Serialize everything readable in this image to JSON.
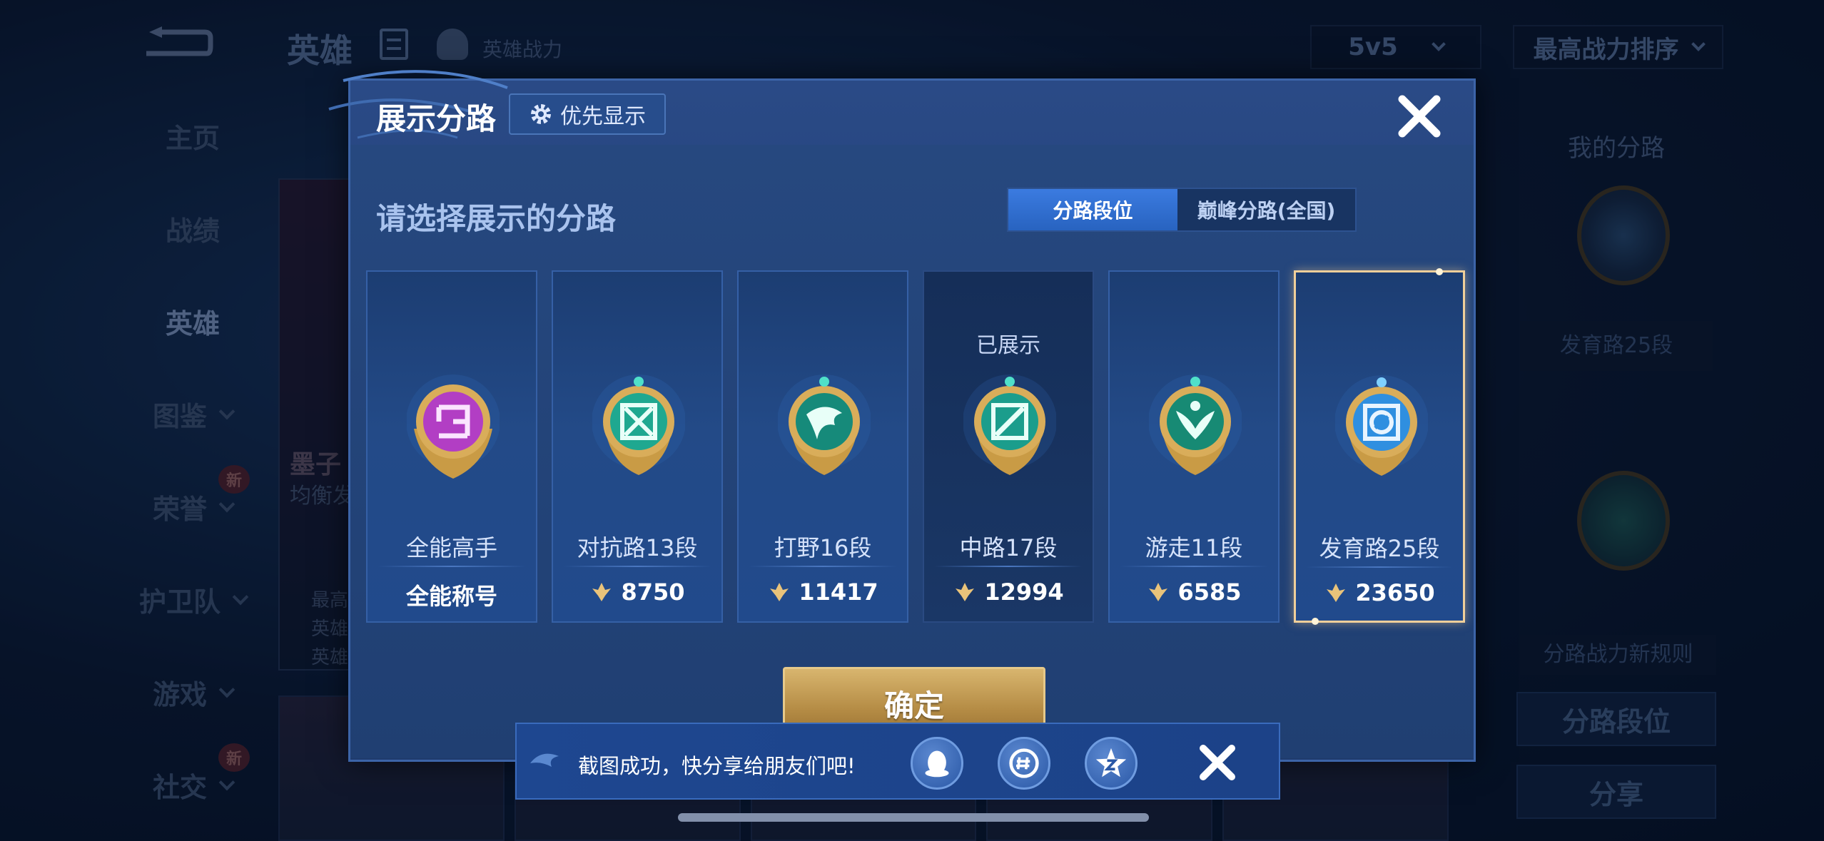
{
  "background": {
    "title": "英雄",
    "power_tab": "英雄战力",
    "mode_select": "5v5",
    "sort_select": "最高战力排序",
    "nav": [
      {
        "label": "主页",
        "active": false,
        "chevron": false,
        "new": false
      },
      {
        "label": "战绩",
        "active": false,
        "chevron": false,
        "new": false
      },
      {
        "label": "英雄",
        "active": true,
        "chevron": false,
        "new": false
      },
      {
        "label": "图鉴",
        "active": false,
        "chevron": true,
        "new": false
      },
      {
        "label": "荣誉",
        "active": false,
        "chevron": true,
        "new": true
      },
      {
        "label": "护卫队",
        "active": false,
        "chevron": true,
        "new": false
      },
      {
        "label": "游戏",
        "active": false,
        "chevron": true,
        "new": false
      },
      {
        "label": "社交",
        "active": false,
        "chevron": true,
        "new": true
      }
    ],
    "new_badge": "新",
    "hero_card": {
      "name": "墨子",
      "sub": "均衡发",
      "info": [
        "最高",
        "英雄",
        "英雄"
      ]
    },
    "right_panel": {
      "title": "我的分路",
      "badge_label": "发育路25段",
      "rule_link": "分路战力新规则",
      "lane_rank_button": "分路段位",
      "share_button": "分享"
    }
  },
  "modal": {
    "title": "展示分路",
    "priority_button": "优先显示",
    "prompt": "请选择展示的分路",
    "toggle": {
      "active": "分路段位",
      "inactive": "巅峰分路(全国)"
    },
    "cards": [
      {
        "name": "全能高手",
        "score": "全能称号",
        "has_power_icon": false,
        "status": "",
        "state": "normal",
        "badge_color": "#b23ec4",
        "badge_icon": "allround-badge-icon"
      },
      {
        "name": "对抗路13段",
        "score": "8750",
        "has_power_icon": true,
        "status": "",
        "state": "normal",
        "badge_color": "#1fa890",
        "badge_icon": "clash-lane-badge-icon"
      },
      {
        "name": "打野16段",
        "score": "11417",
        "has_power_icon": true,
        "status": "",
        "state": "normal",
        "badge_color": "#168a7a",
        "badge_icon": "jungle-badge-icon"
      },
      {
        "name": "中路17段",
        "score": "12994",
        "has_power_icon": true,
        "status": "已展示",
        "state": "shown",
        "badge_color": "#1b9d8c",
        "badge_icon": "mid-lane-badge-icon"
      },
      {
        "name": "游走11段",
        "score": "6585",
        "has_power_icon": true,
        "status": "",
        "state": "normal",
        "badge_color": "#178a74",
        "badge_icon": "roam-badge-icon"
      },
      {
        "name": "发育路25段",
        "score": "23650",
        "has_power_icon": true,
        "status": "",
        "state": "selected",
        "badge_color": "#2f8fe0",
        "badge_icon": "farm-lane-badge-icon"
      }
    ],
    "confirm_button": "确定"
  },
  "toast": {
    "message": "截图成功，快分享给朋友们吧!",
    "icons": [
      "qq-share-icon",
      "wechat-moments-share-icon",
      "qzone-share-icon"
    ]
  },
  "colors": {
    "accent_gold": "#f0cf9a",
    "modal_blue": "#24437b",
    "toggle_active": "#3b7be0"
  }
}
